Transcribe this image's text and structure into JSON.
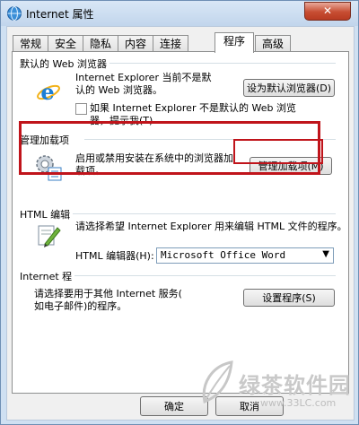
{
  "window": {
    "title": "Internet 属性",
    "close_label": "✕"
  },
  "tabs": [
    {
      "label": "常规"
    },
    {
      "label": "安全"
    },
    {
      "label": "隐私"
    },
    {
      "label": "内容"
    },
    {
      "label": "连接"
    },
    {
      "label": "程序"
    },
    {
      "label": "高级"
    }
  ],
  "active_tab": "程序",
  "default_browser": {
    "group_title": "默认的 Web 浏览器",
    "description_line1": "Internet Explorer 当前不是默",
    "description_line2": "认的 Web 浏览器。",
    "button_label": "设为默认浏览器(D)",
    "checkbox_label_line1": "如果 Internet Explorer 不是默认的 Web 浏览",
    "checkbox_label_line2": "器，提示我(T)",
    "checkbox_checked": false,
    "icon": "ie-logo-icon"
  },
  "manage_addons": {
    "group_title": "管理加载项",
    "description_line1": "启用或禁用安装在系统中的浏览器加",
    "description_line2": "载项。",
    "button_label": "管理加载项(M)",
    "icon": "gears-icon"
  },
  "html_editing": {
    "group_title": "HTML 编辑",
    "description": "请选择希望 Internet Explorer 用来编辑 HTML 文件的程序。",
    "editor_label": "HTML 编辑器(H):",
    "editor_value": "Microsoft Office Word",
    "icon": "editor-pen-icon"
  },
  "internet_programs": {
    "group_title": "Internet 程",
    "description_line1": "请选择要用于其他 Internet 服务(",
    "description_line2": "如电子邮件)的程序。",
    "button_label": "设置程序(S)"
  },
  "footer": {
    "ok_label": "确定",
    "cancel_label": "取消"
  },
  "watermark": {
    "text": "绿茶软件园",
    "url": "www.33LC.com"
  },
  "colors": {
    "highlight": "#c0141b",
    "title_bar": "#c9dcf0",
    "close_button": "#c74d32"
  }
}
